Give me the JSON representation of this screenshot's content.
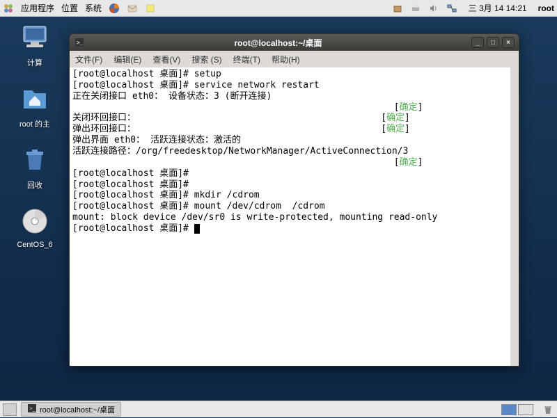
{
  "top_panel": {
    "menu_apps": "应用程序",
    "menu_places": "位置",
    "menu_system": "系统",
    "clock": "三 3月 14 14:21",
    "user": "root"
  },
  "desktop_icons": {
    "computer": "计算",
    "home": "root 的主",
    "trash": "回收",
    "centos": "CentOS_6"
  },
  "terminal": {
    "title": "root@localhost:~/桌面",
    "menubar": {
      "file": "文件(F)",
      "edit": "编辑(E)",
      "view": "查看(V)",
      "search": "搜索 (S)",
      "terminal": "终端(T)",
      "help": "帮助(H)"
    },
    "lines": [
      {
        "text": "[root@localhost 桌面]# setup"
      },
      {
        "text": "[root@localhost 桌面]# service network restart"
      },
      {
        "text": "正在关闭接口 eth0： 设备状态：3 (断开连接)"
      },
      {
        "text": "                                                           [确定]",
        "ok": true
      },
      {
        "text": "关闭环回接口：                                             [确定]",
        "ok": true
      },
      {
        "text": "弹出环回接口：                                             [确定]",
        "ok": true
      },
      {
        "text": "弹出界面 eth0： 活跃连接状态：激活的"
      },
      {
        "text": "活跃连接路径：/org/freedesktop/NetworkManager/ActiveConnection/3"
      },
      {
        "text": "                                                           [确定]",
        "ok": true
      },
      {
        "text": "[root@localhost 桌面]# "
      },
      {
        "text": "[root@localhost 桌面]# "
      },
      {
        "text": "[root@localhost 桌面]# mkdir /cdrom"
      },
      {
        "text": "[root@localhost 桌面]# mount /dev/cdrom  /cdrom"
      },
      {
        "text": "mount: block device /dev/sr0 is write-protected, mounting read-only"
      },
      {
        "text": "[root@localhost 桌面]# ",
        "cursor": true
      }
    ]
  },
  "bottom_panel": {
    "task": "root@localhost:~/桌面"
  },
  "colors": {
    "ok_green": "#4FAE4F"
  }
}
